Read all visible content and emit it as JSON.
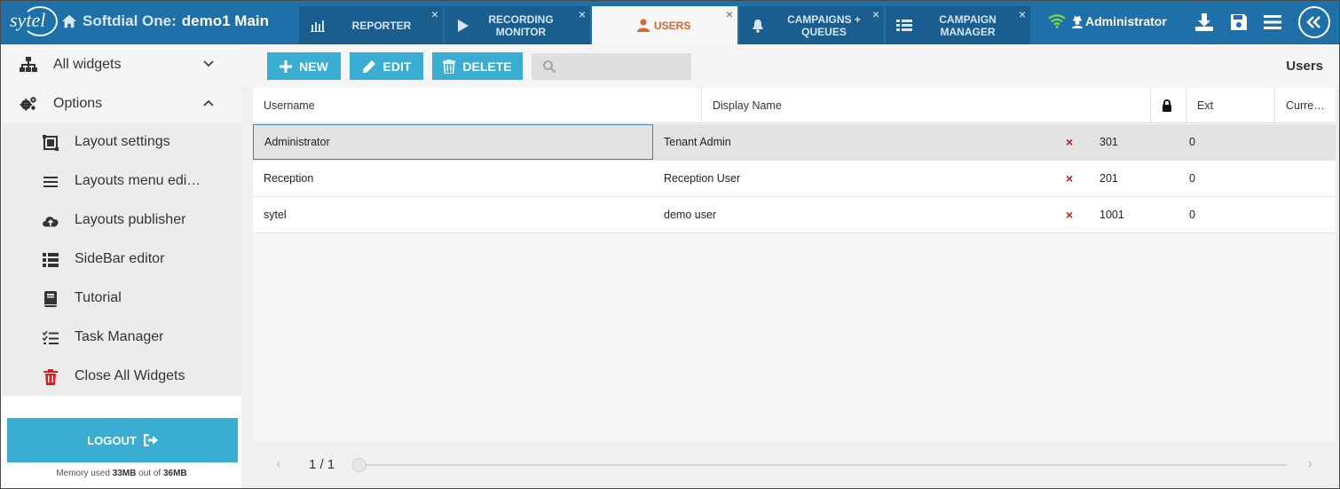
{
  "header": {
    "logo_text": "sytel",
    "app_name": "Softdial One:",
    "environment": "demo1 Main",
    "user": "Administrator"
  },
  "tabs": [
    {
      "label": "REPORTER",
      "icon": "bar-chart-icon",
      "active": false
    },
    {
      "label": "RECORDING MONITOR",
      "icon": "play-icon",
      "active": false
    },
    {
      "label": "USERS",
      "icon": "user-icon",
      "active": true
    },
    {
      "label": "CAMPAIGNS + QUEUES",
      "icon": "bell-icon",
      "active": false
    },
    {
      "label": "CAMPAIGN MANAGER",
      "icon": "grid-list-icon",
      "active": false
    }
  ],
  "tab_close_glyph": "×",
  "sidebar": {
    "sections": [
      {
        "label": "All widgets",
        "icon": "sitemap-icon",
        "chevron": "down"
      },
      {
        "label": "Options",
        "icon": "gears-icon",
        "chevron": "up"
      }
    ],
    "items": [
      {
        "label": "Layout settings",
        "icon": "layout-settings-icon"
      },
      {
        "label": "Layouts menu edi…",
        "icon": "menu-lines-icon"
      },
      {
        "label": "Layouts publisher",
        "icon": "cloud-upload-icon"
      },
      {
        "label": "SideBar editor",
        "icon": "list-icon"
      },
      {
        "label": "Tutorial",
        "icon": "book-icon"
      },
      {
        "label": "Task Manager",
        "icon": "tasks-icon"
      },
      {
        "label": "Close All Widgets",
        "icon": "trash-icon"
      }
    ],
    "logout_label": "LOGOUT",
    "memory": {
      "prefix": "Memory used",
      "used": "33MB",
      "middle": "out of",
      "total": "36MB"
    }
  },
  "toolbar": {
    "new_label": "NEW",
    "edit_label": "EDIT",
    "delete_label": "DELETE",
    "search_value": "",
    "panel_title": "Users"
  },
  "table": {
    "columns": [
      "Username",
      "Display Name",
      "lock-icon",
      "Ext",
      "Curre…"
    ],
    "rows": [
      {
        "username": "Administrator",
        "display_name": "Tenant Admin",
        "locked": "×",
        "ext": "301",
        "current": "0",
        "selected": true
      },
      {
        "username": "Reception",
        "display_name": "Reception User",
        "locked": "×",
        "ext": "201",
        "current": "0",
        "selected": false
      },
      {
        "username": "sytel",
        "display_name": "demo user",
        "locked": "×",
        "ext": "1001",
        "current": "0",
        "selected": false
      }
    ]
  },
  "pager": {
    "page_label": "1 / 1",
    "prev": "‹",
    "next": "›"
  },
  "colors": {
    "header": "#1f6fa8",
    "tab": "#1a5e90",
    "accent": "#3aaed2",
    "active_tab_text": "#e0622d",
    "delete_red": "#d42020",
    "wifi": "#7ddc3a"
  }
}
